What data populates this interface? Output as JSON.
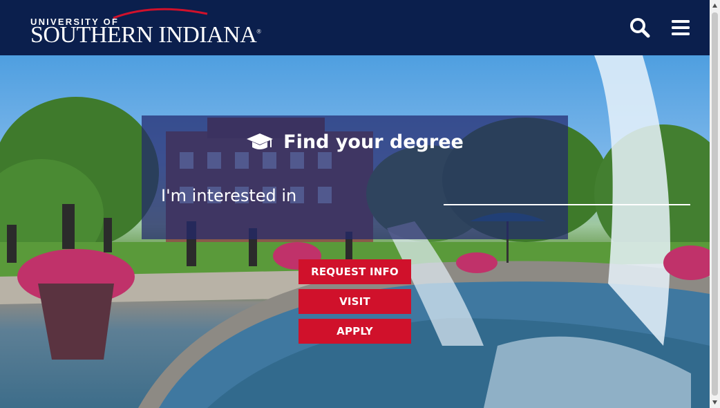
{
  "header": {
    "logo_small": "UNIVERSITY OF",
    "logo_big": "SOUTHERN INDIANA",
    "logo_mark": "®",
    "search_icon": "search-icon",
    "menu_icon": "hamburger-menu-icon",
    "brand_color": "#0b1f4d",
    "accent_color": "#d0112b"
  },
  "finder": {
    "title": "Find your degree",
    "icon": "graduation-cap-icon",
    "label": "I'm interested in",
    "input_value": "",
    "input_placeholder": ""
  },
  "cta": {
    "request_info": "REQUEST INFO",
    "visit": "VISIT",
    "apply": "APPLY"
  }
}
